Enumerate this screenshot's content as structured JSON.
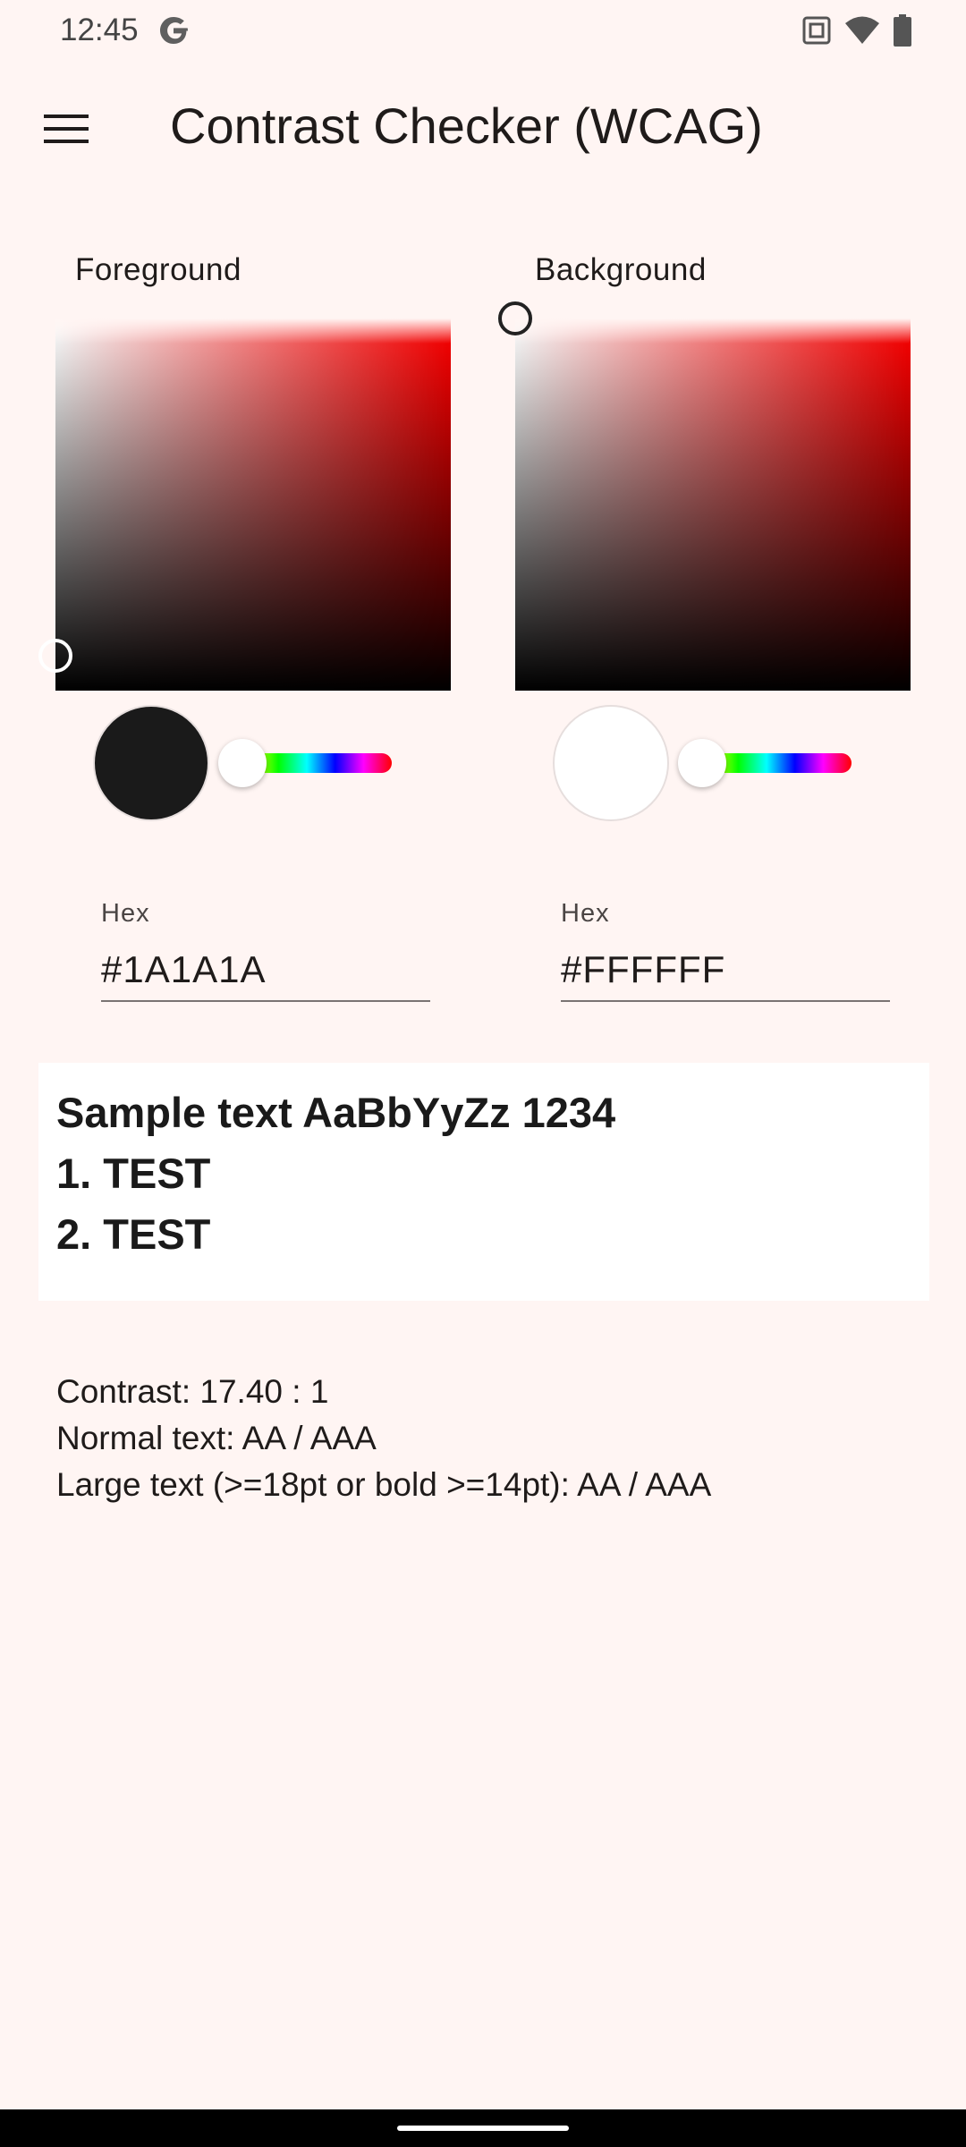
{
  "status_bar": {
    "time": "12:45",
    "icons": [
      "google-icon",
      "nfc-icon",
      "wifi-icon",
      "battery-icon"
    ]
  },
  "app_bar": {
    "title": "Contrast Checker (WCAG)",
    "menu_icon": "menu-icon"
  },
  "foreground": {
    "label": "Foreground",
    "hex_label": "Hex",
    "hex_value": "#1A1A1A",
    "swatch_color": "#1A1A1A"
  },
  "background": {
    "label": "Background",
    "hex_label": "Hex",
    "hex_value": "#FFFFFF",
    "swatch_color": "#FFFFFF"
  },
  "sample": {
    "lines": [
      "Sample text AaBbYyZz 1234",
      "1. TEST",
      "2. TEST"
    ]
  },
  "results": {
    "contrast": "Contrast: 17.40 : 1",
    "normal_text": "Normal text: AA / AAA",
    "large_text": "Large text (>=18pt or bold >=14pt): AA / AAA"
  },
  "colors": {
    "page_background": "#FFF5F3",
    "accent_hue": "#FF0000"
  }
}
